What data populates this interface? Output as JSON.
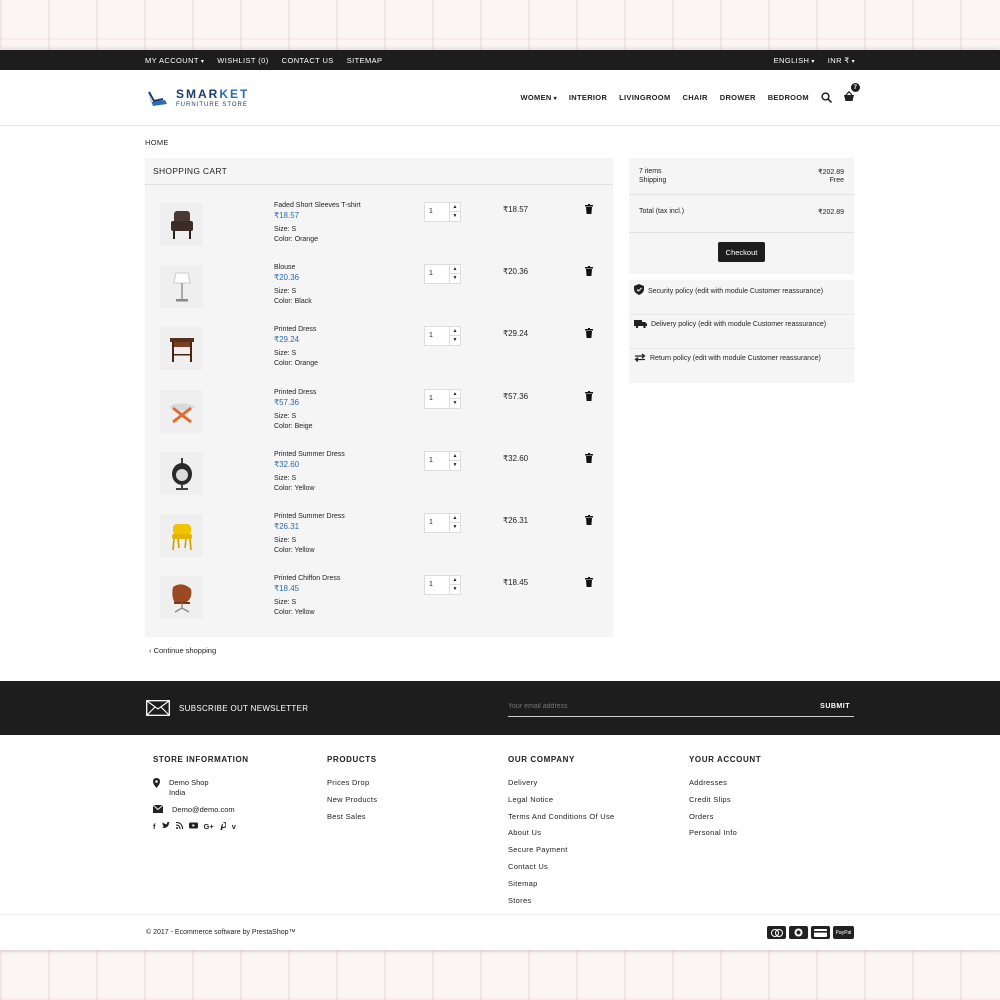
{
  "topbar": {
    "my_account": "MY ACCOUNT",
    "wishlist": "WISHLIST (0)",
    "contact_us": "CONTACT US",
    "sitemap": "SITEMAP",
    "language": "ENGLISH",
    "currency": "INR ₹"
  },
  "header": {
    "logo_prefix": "SMAR",
    "logo_accent": "KET",
    "logo_tagline": "FURNITURE STORE",
    "nav": [
      "WOMEN",
      "INTERIOR",
      "LIVINGROOM",
      "CHAIR",
      "DROWER",
      "BEDROOM"
    ],
    "cart_count": "7"
  },
  "breadcrumb": "HOME",
  "cart": {
    "title": "SHOPPING CART",
    "size_label": "Size:",
    "color_label": "Color:",
    "items": [
      {
        "name": "Faded Short Sleeves T-shirt",
        "price": "₹18.57",
        "size": "S",
        "color": "Orange",
        "qty": "1",
        "total": "₹18.57",
        "icon": "armchair-icon"
      },
      {
        "name": "Blouse",
        "price": "₹20.36",
        "size": "S",
        "color": "Black",
        "qty": "1",
        "total": "₹20.36",
        "icon": "lamp-icon"
      },
      {
        "name": "Printed Dress",
        "price": "₹29.24",
        "size": "S",
        "color": "Orange",
        "qty": "1",
        "total": "₹29.24",
        "icon": "side-table-icon"
      },
      {
        "name": "Printed Dress",
        "price": "₹57.36",
        "size": "S",
        "color": "Beige",
        "qty": "1",
        "total": "₹57.36",
        "icon": "glass-table-icon"
      },
      {
        "name": "Printed Summer Dress",
        "price": "₹32.60",
        "size": "S",
        "color": "Yellow",
        "qty": "1",
        "total": "₹32.60",
        "icon": "hanging-chair-icon"
      },
      {
        "name": "Printed Summer Dress",
        "price": "₹26.31",
        "size": "S",
        "color": "Yellow",
        "qty": "1",
        "total": "₹26.31",
        "icon": "yellow-chair-icon"
      },
      {
        "name": "Printed Chiffon Dress",
        "price": "₹18.45",
        "size": "S",
        "color": "Yellow",
        "qty": "1",
        "total": "₹18.45",
        "icon": "egg-chair-icon"
      }
    ],
    "continue_label": "Continue shopping"
  },
  "summary": {
    "items_label": "7 items",
    "items_value": "₹202.89",
    "shipping_label": "Shipping",
    "shipping_value": "Free",
    "total_label": "Total (tax incl.)",
    "total_value": "₹202.89",
    "checkout_label": "Checkout"
  },
  "reassurance": [
    {
      "text": "Security policy (edit with module Customer reassurance)",
      "icon": "shield-icon"
    },
    {
      "text": "Delivery policy (edit with module Customer reassurance)",
      "icon": "truck-icon"
    },
    {
      "text": "Return policy (edit with module Customer reassurance)",
      "icon": "return-icon"
    }
  ],
  "newsletter": {
    "title": "SUBSCRIBE OUT NEWSLETTER",
    "placeholder": "Your email address",
    "submit": "SUBMIT"
  },
  "footer": {
    "store": {
      "title": "STORE INFORMATION",
      "name": "Demo Shop",
      "country": "India",
      "email": "Demo@demo.com"
    },
    "products": {
      "title": "PRODUCTS",
      "links": [
        "Prices Drop",
        "New Products",
        "Best Sales"
      ]
    },
    "company": {
      "title": "OUR COMPANY",
      "links": [
        "Delivery",
        "Legal Notice",
        "Terms And Conditions Of Use",
        "About Us",
        "Secure Payment",
        "Contact Us",
        "Sitemap",
        "Stores"
      ]
    },
    "account": {
      "title": "YOUR ACCOUNT",
      "links": [
        "Addresses",
        "Credit Slips",
        "Orders",
        "Personal Info"
      ]
    },
    "social": [
      "f",
      "t",
      "rss",
      "yt",
      "G+",
      "p",
      "v"
    ]
  },
  "bottom": {
    "copyright": "© 2017 - Ecommerce software by PrestaShop™",
    "payments": [
      "mastercard",
      "diners",
      "card",
      "PayPal"
    ]
  },
  "colors": {
    "dark": "#1d1d1d",
    "price_blue": "#2b6cb0",
    "panel": "#f5f5f5"
  }
}
